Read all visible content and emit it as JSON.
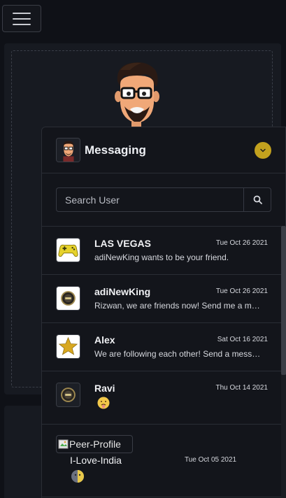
{
  "header": {
    "menu_icon": "hamburger-icon"
  },
  "profile": {
    "avatar_icon": "user-cartoon-avatar"
  },
  "messaging": {
    "title": "Messaging",
    "collapse_icon": "chevron-down-icon",
    "accent_color": "#c2a11e",
    "search": {
      "placeholder": "Search User",
      "value": "",
      "button_icon": "search-icon"
    },
    "conversations": [
      {
        "name": "LAS VEGAS",
        "date": "Tue Oct 26 2021",
        "message": "adiNewKing wants to be your friend.",
        "avatar_icon": "gamepad-icon"
      },
      {
        "name": "adiNewKing",
        "date": "Tue Oct 26 2021",
        "message": "Rizwan, we are friends now! Send me a message.",
        "avatar_icon": "king-badge-icon"
      },
      {
        "name": "Alex",
        "date": "Sat Oct 16 2021",
        "message": "We are following each other! Send a message.",
        "avatar_icon": "star-icon"
      },
      {
        "name": "Ravi",
        "date": "Thu Oct 14 2021",
        "message": "",
        "avatar_icon": "king-badge-icon",
        "emoji_icon": "face-emoji-icon"
      },
      {
        "image_alt": "Peer-Profile",
        "name": "I-Love-India",
        "date": "Tue Oct 05 2021",
        "emoji_icon": "moon-emoji-icon"
      }
    ]
  }
}
